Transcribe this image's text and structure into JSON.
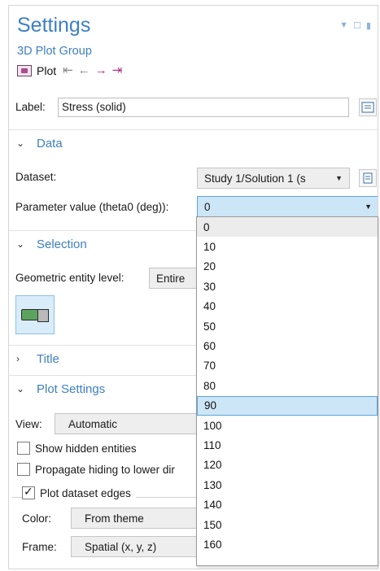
{
  "header": {
    "title": "Settings",
    "subtitle": "3D Plot Group",
    "toolbar_label": "Plot"
  },
  "label_row": {
    "label": "Label:",
    "value": "Stress (solid)"
  },
  "sections": {
    "data": "Data",
    "selection": "Selection",
    "title": "Title",
    "plot_settings": "Plot Settings"
  },
  "data": {
    "dataset_label": "Dataset:",
    "dataset_value": "Study 1/Solution 1 (s",
    "param_label": "Parameter value (theta0 (deg)):",
    "param_value": "0"
  },
  "selection": {
    "geom_label": "Geometric entity level:",
    "geom_value": "Entire"
  },
  "plot_settings": {
    "view_label": "View:",
    "view_value": "Automatic",
    "show_hidden": "Show hidden entities",
    "propagate": "Propagate hiding to lower dir",
    "plot_edges": "Plot dataset edges",
    "color_label": "Color:",
    "color_value": "From theme",
    "frame_label": "Frame:",
    "frame_value": "Spatial  (x, y, z)"
  },
  "dropdown_options": [
    "0",
    "10",
    "20",
    "30",
    "40",
    "50",
    "60",
    "70",
    "80",
    "90",
    "100",
    "110",
    "120",
    "130",
    "140",
    "150",
    "160"
  ],
  "dropdown_selected": "90"
}
